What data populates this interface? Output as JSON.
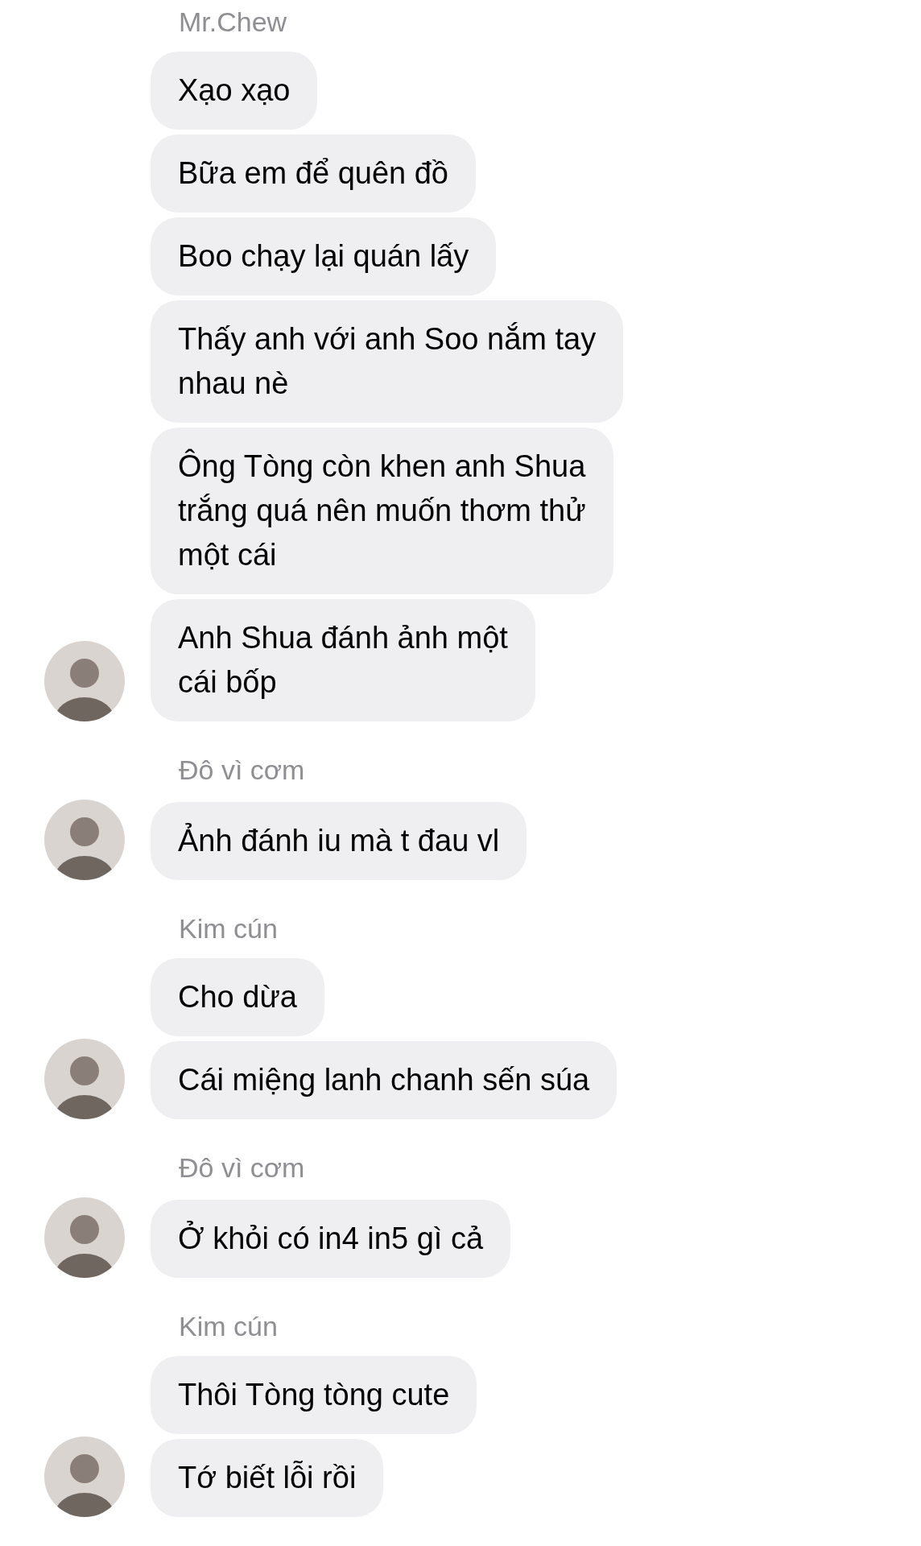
{
  "groups": [
    {
      "sender": "Mr.Chew",
      "messages": [
        {
          "lines": [
            "Xạo xạo"
          ]
        },
        {
          "lines": [
            "Bữa em để quên đồ"
          ]
        },
        {
          "lines": [
            "Boo chạy lại quán lấy"
          ]
        },
        {
          "lines": [
            "Thấy anh với anh Soo nắm tay",
            "nhau nè"
          ]
        },
        {
          "lines": [
            "Ông Tòng còn khen anh Shua",
            "trắng quá nên muốn thơm thử",
            "một cái"
          ]
        },
        {
          "lines": [
            "Anh Shua đánh ảnh một",
            "cái bốp"
          ]
        }
      ]
    },
    {
      "sender": "Đô vì cơm",
      "messages": [
        {
          "lines": [
            "Ảnh đánh iu mà t đau vl"
          ]
        }
      ]
    },
    {
      "sender": "Kim cún",
      "messages": [
        {
          "lines": [
            "Cho dừa"
          ]
        },
        {
          "lines": [
            "Cái miệng lanh chanh sến súa"
          ]
        }
      ]
    },
    {
      "sender": "Đô vì cơm",
      "messages": [
        {
          "lines": [
            "Ở khỏi có in4 in5 gì cả"
          ]
        }
      ]
    },
    {
      "sender": "Kim cún",
      "messages": [
        {
          "lines": [
            "Thôi Tòng tòng cute"
          ]
        },
        {
          "lines": [
            "Tớ biết lỗi rồi"
          ]
        }
      ]
    }
  ]
}
